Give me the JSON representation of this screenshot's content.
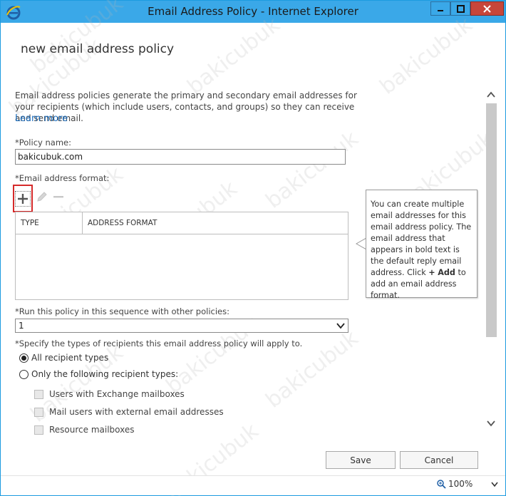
{
  "window": {
    "title": "Email Address Policy - Internet Explorer"
  },
  "page": {
    "title": "new email address policy",
    "intro": "Email address policies generate the primary and secondary email addresses for your recipients (which include users, contacts, and groups) so they can receive and send email.",
    "learn_more": "Learn more"
  },
  "policy_name": {
    "label": "*Policy name:",
    "value": "bakicubuk.com"
  },
  "email_format": {
    "label": "*Email address format:",
    "columns": [
      "TYPE",
      "ADDRESS FORMAT"
    ]
  },
  "tooltip": {
    "line1": "You can create multiple email addresses for this email address policy. The email address that appears in bold text is the default reply email address. Click",
    "plus": "+",
    "add": "Add",
    "line2": "to add an email address format."
  },
  "sequence": {
    "label": "*Run this policy in this sequence with other policies:",
    "value": "1"
  },
  "recipients": {
    "label": "*Specify the types of recipients this email address policy will apply to.",
    "options": [
      "All recipient types",
      "Only the following recipient types:"
    ],
    "selected_index": 0,
    "sub_types": [
      "Users with Exchange mailboxes",
      "Mail users with external email addresses",
      "Resource mailboxes"
    ]
  },
  "actions": {
    "save": "Save",
    "cancel": "Cancel"
  },
  "status": {
    "zoom": "100%"
  },
  "watermark": "bakicubuk",
  "colors": {
    "titlebar": "#3aa8e8",
    "close_button": "#c7463a",
    "link": "#1e6fbf",
    "highlight": "#d52a2a"
  }
}
